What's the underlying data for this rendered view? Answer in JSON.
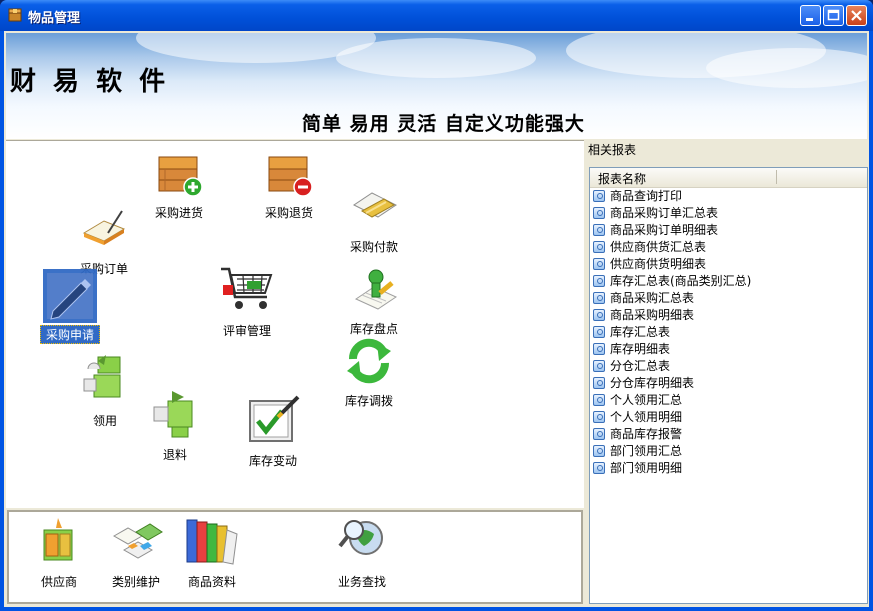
{
  "window": {
    "title": "物品管理"
  },
  "banner": {
    "brand": "财 易 软 件",
    "slogan": "简单 易用 灵活 自定义功能强大"
  },
  "workflow": {
    "items": [
      {
        "id": "purchase-in",
        "label": "采购进货"
      },
      {
        "id": "purchase-return",
        "label": "采购退货"
      },
      {
        "id": "purchase-order",
        "label": "采购订单"
      },
      {
        "id": "purchase-pay",
        "label": "采购付款"
      },
      {
        "id": "purchase-request",
        "label": "采购申请",
        "selected": true
      },
      {
        "id": "review",
        "label": "评审管理"
      },
      {
        "id": "stocktake",
        "label": "库存盘点"
      },
      {
        "id": "requisition",
        "label": "领用"
      },
      {
        "id": "transfer",
        "label": "库存调拨"
      },
      {
        "id": "return-material",
        "label": "退料"
      },
      {
        "id": "stock-change",
        "label": "库存变动"
      }
    ]
  },
  "shortcuts": {
    "items": [
      {
        "id": "supplier",
        "label": "供应商"
      },
      {
        "id": "category",
        "label": "类别维护"
      },
      {
        "id": "goods",
        "label": "商品资料"
      },
      {
        "id": "search",
        "label": "业务查找"
      }
    ]
  },
  "reports": {
    "title": "相关报表",
    "column_header": "报表名称",
    "items": [
      "商品查询打印",
      "商品采购订单汇总表",
      "商品采购订单明细表",
      "供应商供货汇总表",
      "供应商供货明细表",
      "库存汇总表(商品类别汇总)",
      "商品采购汇总表",
      "商品采购明细表",
      "库存汇总表",
      "库存明细表",
      "分仓汇总表",
      "分仓库存明细表",
      "个人领用汇总",
      "个人领用明细",
      "商品库存报警",
      "部门领用汇总",
      "部门领用明细"
    ]
  }
}
